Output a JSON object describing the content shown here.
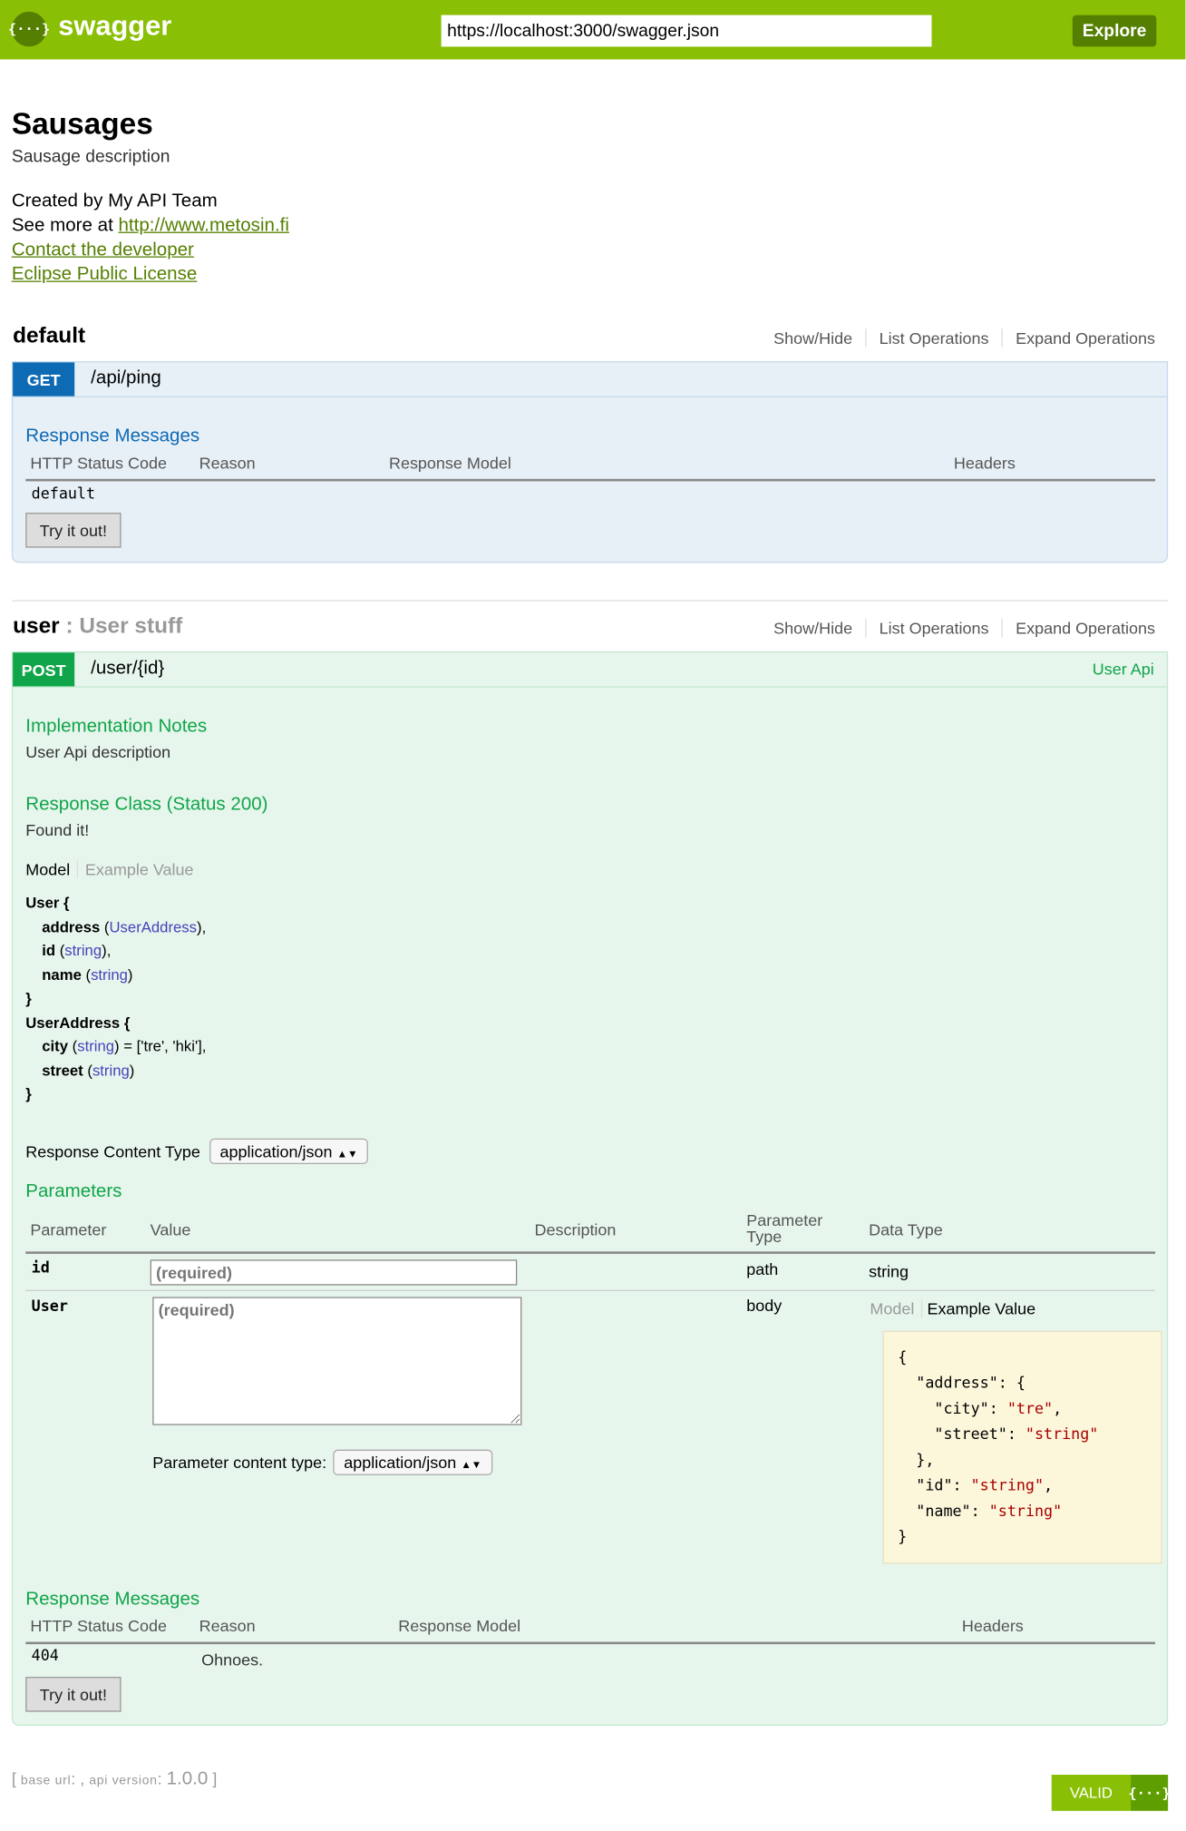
{
  "header": {
    "logo_glyph": "{···}",
    "logo_text": "swagger",
    "url": "https://localhost:3000/swagger.json",
    "explore_label": "Explore"
  },
  "info": {
    "title": "Sausages",
    "description": "Sausage description",
    "created_by": "Created by My API Team",
    "see_more_prefix": "See more at ",
    "see_more_link": "http://www.metosin.fi",
    "contact_link": "Contact the developer",
    "license_link": "Eclipse Public License"
  },
  "resource_links": [
    "Show/Hide",
    "List Operations",
    "Expand Operations"
  ],
  "resources": [
    {
      "name": "default",
      "subtitle": "",
      "operation": {
        "method": "GET",
        "path": "/api/ping",
        "summary": "",
        "response_messages_title": "Response Messages",
        "columns": [
          "HTTP Status Code",
          "Reason",
          "Response Model",
          "Headers"
        ],
        "rows": [
          {
            "code": "default",
            "reason": ""
          }
        ],
        "try_label": "Try it out!"
      }
    },
    {
      "name": "user",
      "subtitle": " : User stuff",
      "operation": {
        "method": "POST",
        "path": "/user/{id}",
        "summary": "User Api",
        "impl_notes_title": "Implementation Notes",
        "impl_notes": "User Api description",
        "response_class_title": "Response Class (Status 200)",
        "response_class_desc": "Found it!",
        "model_tabs": [
          "Model",
          "Example Value"
        ],
        "model_lines": [
          {
            "name": "User {",
            "indent": false,
            "type": "",
            "suffix": ""
          },
          {
            "name": "address",
            "indent": true,
            "type": "UserAddress",
            "suffix": "),"
          },
          {
            "name": "id",
            "indent": true,
            "type": "string",
            "suffix": "),"
          },
          {
            "name": "name",
            "indent": true,
            "type": "string",
            "suffix": ")"
          },
          {
            "name": "}",
            "indent": false,
            "type": "",
            "suffix": ""
          },
          {
            "name": "UserAddress {",
            "indent": false,
            "type": "",
            "suffix": ""
          },
          {
            "name": "city",
            "indent": true,
            "type": "string",
            "suffix": ") = ['tre', 'hki'],"
          },
          {
            "name": "street",
            "indent": true,
            "type": "string",
            "suffix": ")"
          },
          {
            "name": "}",
            "indent": false,
            "type": "",
            "suffix": ""
          }
        ],
        "response_content_type_label": "Response Content Type",
        "response_content_type": "application/json",
        "parameters_title": "Parameters",
        "param_columns": [
          "Parameter",
          "Value",
          "Description",
          "Parameter Type",
          "Data Type"
        ],
        "params": [
          {
            "name": "id",
            "placeholder": "(required)",
            "param_type": "path",
            "data_type": "string"
          },
          {
            "name": "User",
            "placeholder": "(required)",
            "param_type": "body",
            "data_type_tabs": [
              "Model",
              "Example Value"
            ]
          }
        ],
        "param_content_type_label": "Parameter content type:",
        "param_content_type": "application/json",
        "example_value": "{\n  \"address\": {\n    \"city\": \"tre\",\n    \"street\": \"string\"\n  },\n  \"id\": \"string\",\n  \"name\": \"string\"\n}",
        "response_messages_title": "Response Messages",
        "columns": [
          "HTTP Status Code",
          "Reason",
          "Response Model",
          "Headers"
        ],
        "rows": [
          {
            "code": "404",
            "reason": "Ohnoes."
          }
        ],
        "try_label": "Try it out!"
      }
    }
  ],
  "footer": {
    "base_url_label": "base url",
    "base_url_value": "",
    "api_version_label": "api version",
    "api_version": "1.0.0",
    "valid_label": "VALID",
    "valid_glyph": "{···}"
  },
  "colors": {
    "header": "#89bf04",
    "get": "#0f6ab4",
    "post": "#10a54a",
    "link": "#547f00"
  }
}
